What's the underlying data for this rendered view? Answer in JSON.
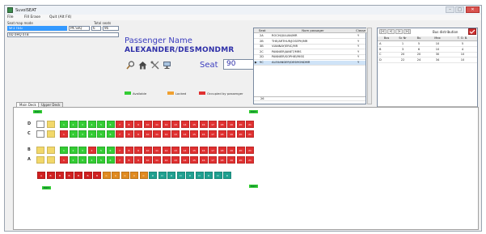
{
  "window": {
    "title": "SuvolSEAT"
  },
  "menu": [
    "File",
    "Fill Erase",
    "Quit (Alt F4)"
  ],
  "window_controls": [
    "–",
    "□",
    "✕"
  ],
  "left_panel": {
    "label_search": "Seat map mode",
    "label_total": "Total seats",
    "field_mode": "SF1 TEG",
    "field_sub": "PK SeQ",
    "field_num": "6",
    "field_total": "96",
    "field_code": "0D 0HQ 0TB"
  },
  "passenger": {
    "heading": "Passenger Name",
    "name": "ALEXANDER/DESMONDMR",
    "seat_label": "Seat",
    "seat_value": "90"
  },
  "tools": [
    "magnifier-icon",
    "home-icon",
    "tools-icon",
    "monitor-icon"
  ],
  "legend": [
    {
      "label": "Available",
      "color": "#33cc33"
    },
    {
      "label": "Locked",
      "color": "#f0a030"
    },
    {
      "label": "Occupied by passenger",
      "color": "#e03030"
    }
  ],
  "passenger_grid": {
    "headers": [
      "Seat",
      "Nom passager",
      "Classe"
    ],
    "rows": [
      {
        "seat": "2A",
        "name": "ROCHI/JULIAN/MR",
        "cls": "Y"
      },
      {
        "seat": "2B",
        "name": "THE/ARTHUR/JOSEPH/MR",
        "cls": "Y"
      },
      {
        "seat": "3B",
        "name": "VIANNAY/ERIC/MR",
        "cls": "Y"
      },
      {
        "seat": "2C",
        "name": "PANNIER/JANET/MRS",
        "cls": "Y"
      },
      {
        "seat": "2D",
        "name": "PANNIER/SOPHIE/MISS",
        "cls": "Y"
      },
      {
        "seat": "9C",
        "name": "ALEXANDER/DESMONDMR",
        "cls": "Y"
      }
    ],
    "footer": "26"
  },
  "distribution": {
    "title": "Bus distribution",
    "nav": [
      "|<",
      "<",
      ">",
      ">|"
    ],
    "headers": [
      "Bus",
      "Sc Nr",
      "Bu",
      "Max",
      "T. O. B."
    ],
    "rows": [
      [
        "A",
        "1",
        "5",
        "10",
        "5"
      ],
      [
        "B",
        "3",
        "6",
        "10",
        "4"
      ],
      [
        "C",
        "20",
        "20",
        "30",
        "10"
      ],
      [
        "D",
        "22",
        "24",
        "34",
        "10"
      ]
    ],
    "total": "29"
  },
  "tabs": [
    "Main Deck",
    "Upper Deck"
  ],
  "exits": [
    "EXIT",
    "EXIT",
    "EXIT",
    "EXIT"
  ],
  "seatmap": {
    "row_labels": [
      "D",
      "C",
      "B",
      "A"
    ],
    "col_labels": [
      "1",
      "2",
      "3",
      "4",
      "5",
      "6",
      "7",
      "8",
      "9",
      "10",
      "11",
      "12",
      "13",
      "14",
      "15",
      "16",
      "17",
      "18",
      "19",
      "20",
      "21"
    ],
    "rows": {
      "D": [
        "g",
        "g",
        "g",
        "g",
        "g",
        "g",
        "r",
        "r",
        "r",
        "r",
        "r",
        "r",
        "r",
        "r",
        "r",
        "r",
        "r",
        "r",
        "r",
        "r",
        "r"
      ],
      "C": [
        "r",
        "g",
        "g",
        "g",
        "g",
        "g",
        "r",
        "r",
        "r",
        "r",
        "r",
        "r",
        "r",
        "r",
        "r",
        "r",
        "r",
        "r",
        "r",
        "r",
        "r"
      ],
      "B": [
        "g",
        "g",
        "g",
        "r",
        "g",
        "g",
        "r",
        "r",
        "r",
        "r",
        "r",
        "r",
        "r",
        "r",
        "r",
        "r",
        "r",
        "r",
        "r",
        "r",
        "r"
      ],
      "A": [
        "r",
        "g",
        "g",
        "g",
        "g",
        "g",
        "r",
        "r",
        "r",
        "r",
        "r",
        "r",
        "r",
        "r",
        "r",
        "r",
        "r",
        "r",
        "r",
        "r",
        "r"
      ]
    },
    "bottom_row": {
      "labels": [
        "A",
        "B",
        "B",
        "B",
        "B",
        "B",
        "B",
        "C",
        "C",
        "C",
        "C",
        "C",
        "D",
        "D",
        "D",
        "D",
        "D",
        "D",
        "D",
        "D",
        "D"
      ],
      "colors": [
        "#d02020",
        "#d02020",
        "#d02020",
        "#d02020",
        "#d02020",
        "#d02020",
        "#d02020",
        "#e08a20",
        "#e08a20",
        "#e08a20",
        "#e08a20",
        "#e08a20",
        "#20a090",
        "#20a090",
        "#20a090",
        "#20a090",
        "#20a090",
        "#20a090",
        "#20a090",
        "#20a090",
        "#20a090"
      ]
    }
  },
  "colors": {
    "green": "#33cc33",
    "red": "#e03030",
    "blue_text": "#3b3dbf"
  }
}
